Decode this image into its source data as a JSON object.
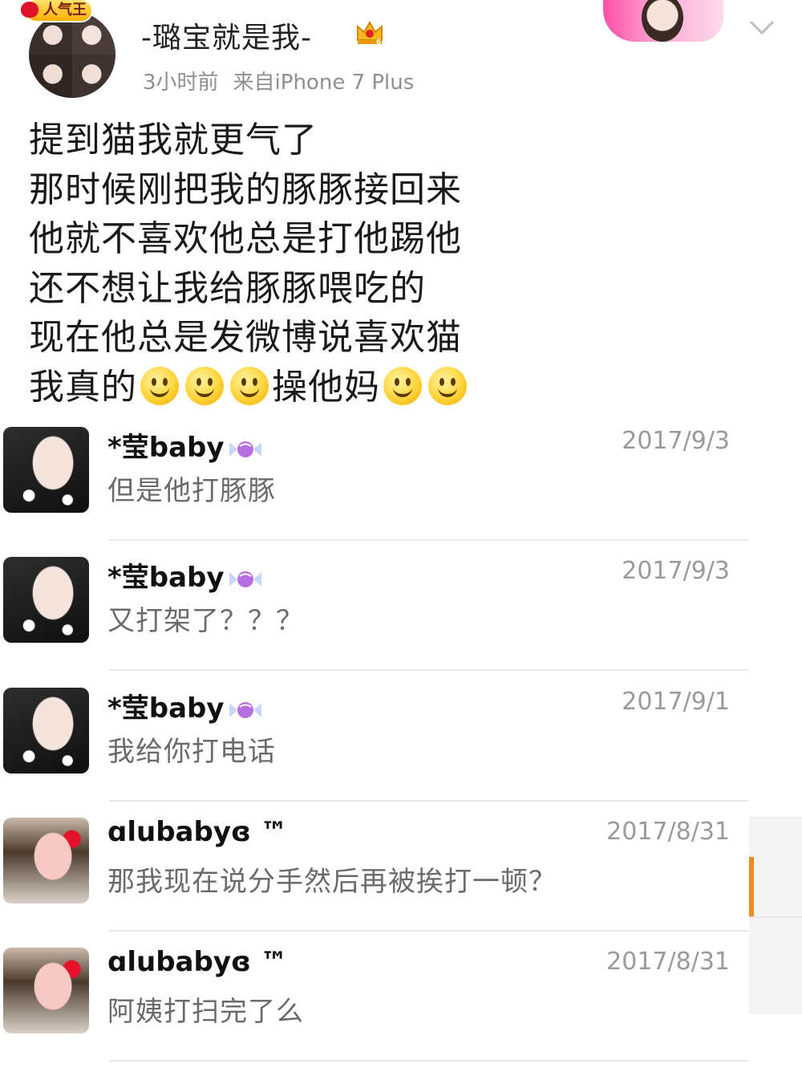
{
  "post": {
    "badge": "人气王",
    "author": "-璐宝就是我-",
    "meta": {
      "time": "3小时前",
      "source": "来自iPhone 7 Plus"
    },
    "lines": [
      {
        "text": "提到猫我就更气了"
      },
      {
        "text": "那时候刚把我的豚豚接回来"
      },
      {
        "text": "他就不喜欢他总是打他踢他"
      },
      {
        "text": "还不想让我给豚豚喂吃的"
      },
      {
        "text": "现在他总是发微博说喜欢猫"
      }
    ],
    "last_line": {
      "part1": "我真的",
      "part2": "操他妈"
    }
  },
  "comments": [
    {
      "name": "*莹baby",
      "date": "2017/9/3",
      "text": "但是他打豚豚",
      "avatar": "a"
    },
    {
      "name": "*莹baby",
      "date": "2017/9/3",
      "text": "又打架了？？？",
      "avatar": "a"
    },
    {
      "name": "*莹baby",
      "date": "2017/9/1",
      "text": "我给你打电话",
      "avatar": "a"
    },
    {
      "name": "ɑlubabyɞ ™",
      "date": "2017/8/31",
      "text": "那我现在说分手然后再被挨打一顿？",
      "avatar": "b"
    },
    {
      "name": "ɑlubabyɞ ™",
      "date": "2017/8/31",
      "text": "阿姨打扫完了么",
      "avatar": "b"
    }
  ],
  "colors": {
    "meta_gray": "#8f8f8f",
    "comment_gray": "#6a6a6a",
    "accent_orange": "#f08a24"
  }
}
